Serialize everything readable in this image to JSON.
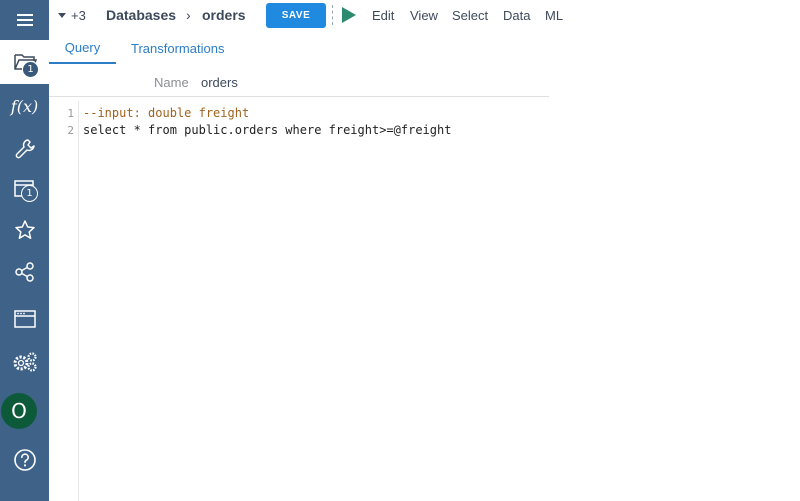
{
  "sidebar": {
    "items": [
      {
        "icon": "hamburger-menu-icon"
      },
      {
        "icon": "folder-open-icon",
        "badge": "1"
      },
      {
        "icon": "function-icon",
        "label": "f(x)"
      },
      {
        "icon": "wrench-icon"
      },
      {
        "icon": "window-icon",
        "badge": "1"
      },
      {
        "icon": "star-icon"
      },
      {
        "icon": "share-nodes-icon"
      },
      {
        "icon": "browser-window-icon"
      },
      {
        "icon": "gears-icon"
      },
      {
        "icon": "help-icon",
        "label": "?"
      }
    ],
    "avatar_initial": "O"
  },
  "breadcrumb": {
    "more": "+3",
    "parent": "Databases",
    "separator": "›",
    "current": "orders"
  },
  "toolbar": {
    "save_label": "SAVE",
    "menus": [
      "Edit",
      "View",
      "Select",
      "Data",
      "ML"
    ]
  },
  "tabs": [
    {
      "label": "Query",
      "active": true
    },
    {
      "label": "Transformations",
      "active": false
    }
  ],
  "form": {
    "name_label": "Name",
    "name_value": "orders"
  },
  "editor": {
    "lines": [
      {
        "number": "1",
        "text": "--input: double freight"
      },
      {
        "number": "2",
        "text": "select * from public.orders where freight>=@freight"
      }
    ]
  },
  "colors": {
    "sidebar": "#3f6288",
    "accent": "#1f8ae0",
    "run": "#2e8a6e",
    "avatar": "#0d5a3a",
    "comment": "#a0631e"
  }
}
